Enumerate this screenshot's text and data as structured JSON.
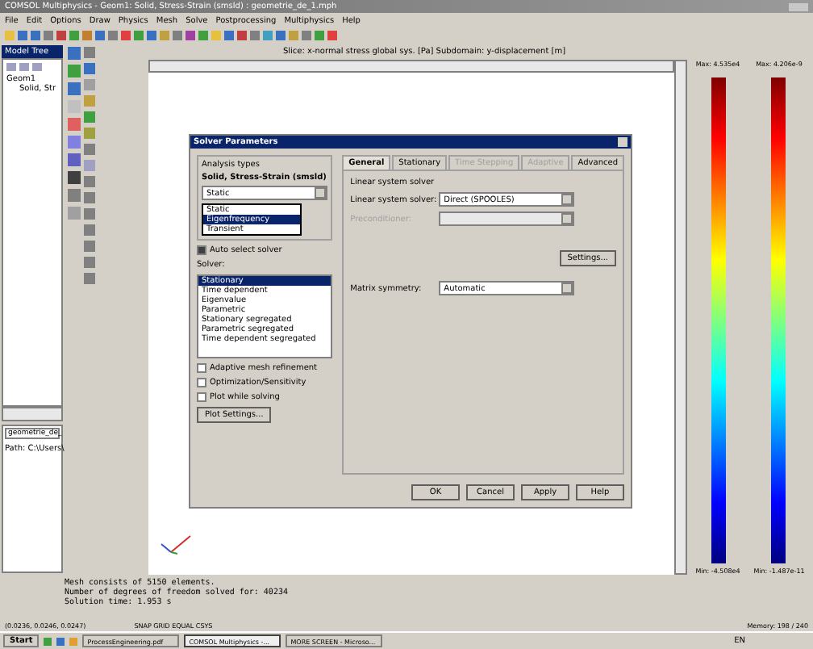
{
  "window": {
    "title": "COMSOL Multiphysics - Geom1: Solid, Stress-Strain (smsld) : geometrie_de_1.mph"
  },
  "menu": [
    "File",
    "Edit",
    "Options",
    "Draw",
    "Physics",
    "Mesh",
    "Solve",
    "Postprocessing",
    "Multiphysics",
    "Help"
  ],
  "model_tree": {
    "title": "Model Tree",
    "items": [
      {
        "label": "Geom1",
        "children": [
          {
            "label": "Solid, Str"
          }
        ]
      }
    ],
    "file": "geometrie_de_",
    "path": "Path: C:\\Users\\"
  },
  "plot": {
    "title": "Slice: x-normal stress global sys. [Pa]  Subdomain: y-displacement [m]",
    "colorbars": [
      {
        "max": "Max: 4.535e4",
        "min": "Min: -4.508e4"
      },
      {
        "max": "Max: 4.206e-9",
        "min": "Min: -1.487e-11"
      }
    ]
  },
  "dialog": {
    "title": "Solver Parameters",
    "analysis_label": "Analysis types",
    "physics": "Solid, Stress-Strain (smsld)",
    "analysis_value": "Static",
    "analysis_options": [
      {
        "label": "Static",
        "selected": false
      },
      {
        "label": "Eigenfrequency",
        "selected": true
      },
      {
        "label": "Transient",
        "selected": false
      }
    ],
    "auto_select": {
      "label": "Auto select solver",
      "checked": true
    },
    "solver_label": "Solver:",
    "solvers": [
      {
        "label": "Stationary",
        "selected": true
      },
      {
        "label": "Time dependent",
        "selected": false
      },
      {
        "label": "Eigenvalue",
        "selected": false
      },
      {
        "label": "Parametric",
        "selected": false
      },
      {
        "label": "Stationary segregated",
        "selected": false
      },
      {
        "label": "Parametric segregated",
        "selected": false
      },
      {
        "label": "Time dependent segregated",
        "selected": false
      }
    ],
    "options": [
      {
        "label": "Adaptive mesh refinement",
        "checked": false
      },
      {
        "label": "Optimization/Sensitivity",
        "checked": false
      },
      {
        "label": "Plot while solving",
        "checked": false
      }
    ],
    "plot_settings": "Plot Settings...",
    "tabs": [
      {
        "label": "General",
        "selected": true,
        "disabled": false
      },
      {
        "label": "Stationary",
        "selected": false,
        "disabled": false
      },
      {
        "label": "Time Stepping",
        "selected": false,
        "disabled": true
      },
      {
        "label": "Adaptive",
        "selected": false,
        "disabled": true
      },
      {
        "label": "Advanced",
        "selected": false,
        "disabled": false
      }
    ],
    "group_label": "Linear system solver",
    "fields": [
      {
        "label": "Linear system solver:",
        "value": "Direct (SPOOLES)",
        "disabled": false
      },
      {
        "label": "Preconditioner:",
        "disabled": true
      }
    ],
    "settings": "Settings...",
    "symmetry_label": "Matrix symmetry:",
    "symmetry_value": "Automatic",
    "buttons": [
      "OK",
      "Cancel",
      "Apply",
      "Help"
    ]
  },
  "log": [
    "Mesh consists of 5150 elements.",
    "Number of degrees of freedom solved for: 40234",
    "Solution time: 1.953 s"
  ],
  "status_bar": {
    "coords": "(0.0236, 0.0246, 0.0247)",
    "modes": "SNAP GRID EQUAL CSYS",
    "memory": "Memory: 198 / 240"
  },
  "taskbar": {
    "start": "Start",
    "tasks": [
      {
        "label": "ProcessEngineering.pdf",
        "selected": false
      },
      {
        "label": "COMSOL Multiphysics -...",
        "selected": true
      },
      {
        "label": "MORE SCREEN - Microso...",
        "selected": false
      }
    ],
    "lang": "EN"
  }
}
